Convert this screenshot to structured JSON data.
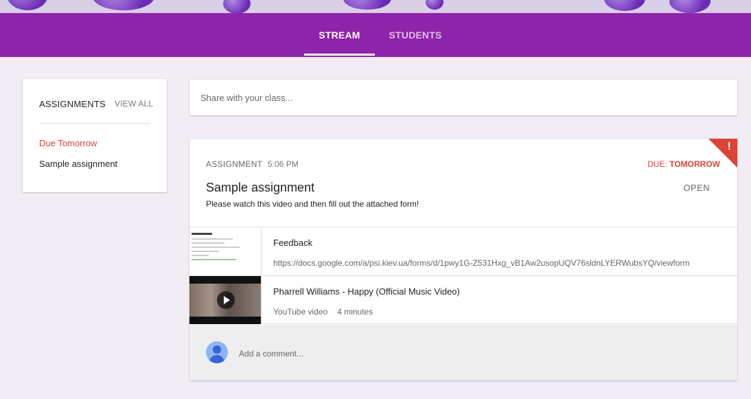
{
  "nav": {
    "tabs": [
      {
        "label": "STREAM",
        "active": true
      },
      {
        "label": "STUDENTS",
        "active": false
      }
    ]
  },
  "sidebar": {
    "title": "ASSIGNMENTS",
    "view_all": "VIEW ALL",
    "due_label": "Due Tomorrow",
    "items": [
      "Sample assignment"
    ]
  },
  "share": {
    "placeholder": "Share with your class..."
  },
  "post": {
    "type_label": "ASSIGNMENT",
    "time": "5:06 PM",
    "due_prefix": "DUE: ",
    "due_value": "TOMORROW",
    "title": "Sample assignment",
    "open_label": "OPEN",
    "description": "Please watch this video and then fill out the attached form!",
    "attachments": [
      {
        "title": "Feedback",
        "subtitle": "https://docs.google.com/a/psi.kiev.ua/forms/d/1pwy1G-Z531Hxg_vB1Aw2usopUQV76sldnLYERWubsYQ/viewform"
      },
      {
        "title": "Pharrell Williams - Happy (Official Music Video)",
        "subtitle": "YouTube video",
        "duration": "4 minutes"
      }
    ],
    "comment_placeholder": "Add a comment..."
  },
  "colors": {
    "brand": "#8e24aa",
    "due": "#db4437",
    "background": "#f2edf4"
  }
}
